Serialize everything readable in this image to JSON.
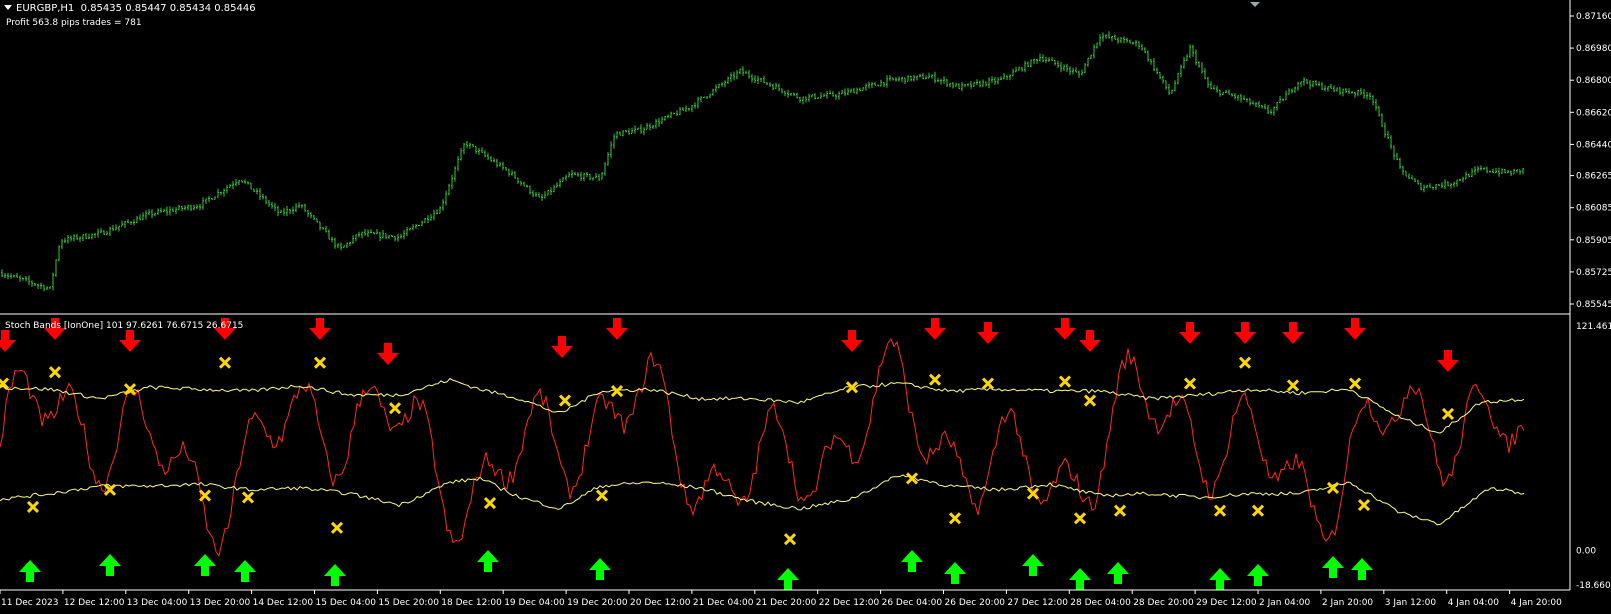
{
  "header": {
    "symbol": "EURGBP,H1",
    "ohlc": "0.85435 0.85447 0.85434 0.85446",
    "profit_text": "Profit 563.8 pips trades = 781"
  },
  "indicator": {
    "label": "Stoch Bands [IonOne] 101 97.6261 76.6715 26.6715"
  },
  "colors": {
    "background": "#000000",
    "bars": "#32cd32",
    "stoch_line": "#ff2a1a",
    "bands": "#ffff80",
    "sell_arrow": "#ff0000",
    "buy_arrow": "#00ff00",
    "cross": "#ffd700",
    "axis": "#ffffff"
  },
  "chart_data": [
    {
      "type": "ohlc",
      "symbol": "EURGBP",
      "timeframe": "H1",
      "y_ticks": [
        "0.87160",
        "0.86980",
        "0.86800",
        "0.86620",
        "0.86440",
        "0.86265",
        "0.86085",
        "0.85905",
        "0.85725",
        "0.85545"
      ],
      "ylim": [
        0.85545,
        0.8716
      ],
      "close_path": [
        [
          0,
          0.8572
        ],
        [
          50,
          0.8563
        ],
        [
          60,
          0.859
        ],
        [
          100,
          0.8594
        ],
        [
          150,
          0.8605
        ],
        [
          200,
          0.861
        ],
        [
          240,
          0.8625
        ],
        [
          280,
          0.8605
        ],
        [
          300,
          0.861
        ],
        [
          340,
          0.8585
        ],
        [
          360,
          0.8594
        ],
        [
          400,
          0.8592
        ],
        [
          440,
          0.8608
        ],
        [
          465,
          0.8645
        ],
        [
          510,
          0.8628
        ],
        [
          540,
          0.8613
        ],
        [
          570,
          0.8627
        ],
        [
          600,
          0.8625
        ],
        [
          615,
          0.865
        ],
        [
          640,
          0.8652
        ],
        [
          690,
          0.8665
        ],
        [
          740,
          0.8685
        ],
        [
          800,
          0.867
        ],
        [
          840,
          0.8672
        ],
        [
          890,
          0.868
        ],
        [
          930,
          0.8682
        ],
        [
          960,
          0.8676
        ],
        [
          1000,
          0.868
        ],
        [
          1040,
          0.8693
        ],
        [
          1080,
          0.8683
        ],
        [
          1100,
          0.8705
        ],
        [
          1140,
          0.87
        ],
        [
          1170,
          0.8672
        ],
        [
          1190,
          0.8698
        ],
        [
          1210,
          0.8675
        ],
        [
          1240,
          0.867
        ],
        [
          1270,
          0.8662
        ],
        [
          1300,
          0.868
        ],
        [
          1330,
          0.8675
        ],
        [
          1370,
          0.8672
        ],
        [
          1400,
          0.863
        ],
        [
          1420,
          0.862
        ],
        [
          1450,
          0.8622
        ],
        [
          1480,
          0.863
        ],
        [
          1510,
          0.8628
        ],
        [
          1525,
          0.863
        ]
      ]
    },
    {
      "type": "line",
      "name": "Stoch Bands [IonOne]",
      "params": [
        101,
        97.6261,
        76.6715,
        26.6715
      ],
      "y_ticks": [
        "121.4615",
        "0.00",
        "-18.6606"
      ],
      "ylim": [
        -18.6606,
        121.4615
      ],
      "series": [
        {
          "name": "upper_band",
          "values": [
            [
              0,
              86
            ],
            [
              50,
              85
            ],
            [
              100,
              80
            ],
            [
              150,
              86
            ],
            [
              200,
              85
            ],
            [
              250,
              84
            ],
            [
              300,
              87
            ],
            [
              350,
              82
            ],
            [
              400,
              82
            ],
            [
              450,
              90
            ],
            [
              480,
              85
            ],
            [
              520,
              80
            ],
            [
              560,
              72
            ],
            [
              600,
              84
            ],
            [
              650,
              85
            ],
            [
              700,
              80
            ],
            [
              750,
              80
            ],
            [
              800,
              78
            ],
            [
              850,
              86
            ],
            [
              900,
              88
            ],
            [
              950,
              84
            ],
            [
              1000,
              85
            ],
            [
              1050,
              84
            ],
            [
              1100,
              84
            ],
            [
              1150,
              80
            ],
            [
              1200,
              82
            ],
            [
              1250,
              85
            ],
            [
              1300,
              83
            ],
            [
              1350,
              85
            ],
            [
              1400,
              70
            ],
            [
              1440,
              62
            ],
            [
              1480,
              78
            ],
            [
              1525,
              80
            ]
          ]
        },
        {
          "name": "lower_band",
          "values": [
            [
              0,
              27
            ],
            [
              50,
              30
            ],
            [
              100,
              34
            ],
            [
              150,
              34
            ],
            [
              200,
              35
            ],
            [
              250,
              32
            ],
            [
              300,
              33
            ],
            [
              350,
              30
            ],
            [
              400,
              24
            ],
            [
              450,
              36
            ],
            [
              480,
              38
            ],
            [
              520,
              28
            ],
            [
              560,
              22
            ],
            [
              600,
              34
            ],
            [
              650,
              36
            ],
            [
              700,
              33
            ],
            [
              750,
              26
            ],
            [
              800,
              22
            ],
            [
              850,
              27
            ],
            [
              900,
              40
            ],
            [
              950,
              34
            ],
            [
              1000,
              32
            ],
            [
              1050,
              35
            ],
            [
              1100,
              29
            ],
            [
              1150,
              30
            ],
            [
              1200,
              28
            ],
            [
              1250,
              30
            ],
            [
              1300,
              30
            ],
            [
              1350,
              36
            ],
            [
              1400,
              20
            ],
            [
              1440,
              14
            ],
            [
              1490,
              33
            ],
            [
              1525,
              30
            ]
          ]
        }
      ]
    }
  ],
  "x_ticks": [
    "11 Dec 2023",
    "12 Dec 12:00",
    "13 Dec 04:00",
    "13 Dec 20:00",
    "14 Dec 12:00",
    "15 Dec 04:00",
    "15 Dec 20:00",
    "18 Dec 12:00",
    "19 Dec 04:00",
    "19 Dec 20:00",
    "20 Dec 12:00",
    "21 Dec 04:00",
    "21 Dec 20:00",
    "22 Dec 12:00",
    "26 Dec 04:00",
    "26 Dec 20:00",
    "27 Dec 12:00",
    "28 Dec 04:00",
    "28 Dec 20:00",
    "29 Dec 12:00",
    "2 Jan 04:00",
    "2 Jan 20:00",
    "3 Jan 12:00",
    "4 Jan 04:00",
    "4 Jan 20:00"
  ]
}
